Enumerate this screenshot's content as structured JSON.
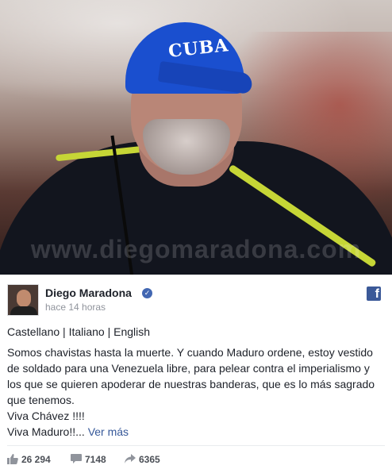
{
  "photo": {
    "cap_text": "CUBA",
    "watermark": "www.diegomaradona.com"
  },
  "post": {
    "author": "Diego Maradona",
    "timestamp": "hace 14 horas",
    "languages": "Castellano | Italiano | English",
    "body_lines": [
      "Somos chavistas hasta la muerte. Y cuando Maduro ordene, estoy vestido de soldado para una Venezuela libre, para pelear contra el imperialismo y los que se quieren apoderar de nuestras banderas, que es lo más sagrado que tenemos.",
      "Viva Chávez !!!!",
      "Viva Maduro!!..."
    ],
    "see_more": "Ver más"
  },
  "stats": {
    "likes": "26 294",
    "comments": "7148",
    "shares": "6365"
  },
  "icons": {
    "verified": "verified-check-icon",
    "facebook": "facebook-logo-icon",
    "like": "thumbs-up-icon",
    "comment": "comment-bubble-icon",
    "share": "share-arrow-icon"
  },
  "colors": {
    "link": "#365899",
    "facebook_blue": "#3b5998",
    "meta_gray": "#90949c"
  }
}
